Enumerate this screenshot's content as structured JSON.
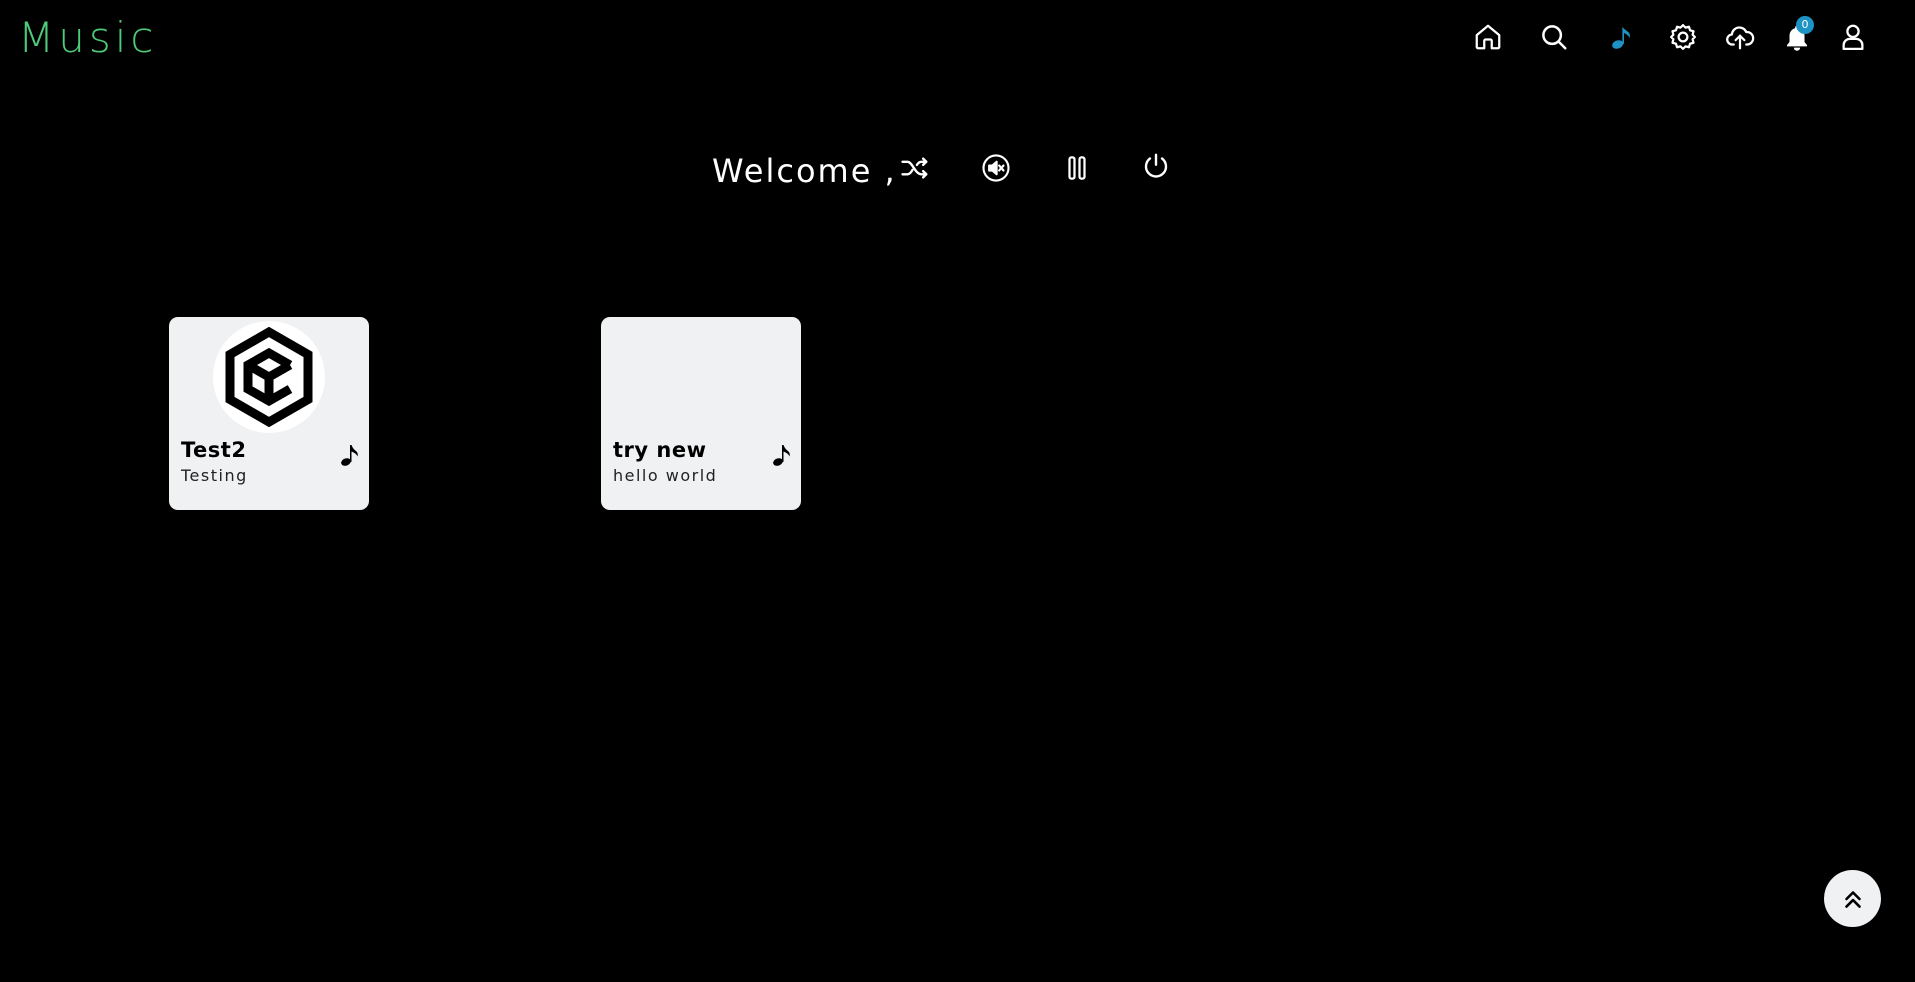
{
  "app": {
    "title": "Music",
    "brand_color": "#4fc97a"
  },
  "nav": {
    "items": [
      {
        "name": "home",
        "icon": "home-icon"
      },
      {
        "name": "search",
        "icon": "search-icon"
      },
      {
        "name": "music",
        "icon": "music-note-icon",
        "active": true,
        "color": "#1c93c4"
      },
      {
        "name": "settings",
        "icon": "gear-icon"
      },
      {
        "name": "upload",
        "icon": "cloud-upload-icon"
      },
      {
        "name": "notifications",
        "icon": "bell-icon",
        "badge": "0"
      },
      {
        "name": "profile",
        "icon": "user-icon"
      }
    ],
    "notification_count": "0"
  },
  "welcome": {
    "text": "Welcome ,",
    "controls": [
      {
        "name": "shuffle",
        "icon": "shuffle-icon"
      },
      {
        "name": "mute",
        "icon": "mute-icon"
      },
      {
        "name": "pause",
        "icon": "pause-icon"
      },
      {
        "name": "power",
        "icon": "power-icon"
      }
    ]
  },
  "cards": [
    {
      "title": "Test2",
      "subtitle": "Testing",
      "art": "cube-logo-icon",
      "icon": "music-note-icon"
    },
    {
      "title": "try new",
      "subtitle": "hello world",
      "art": "",
      "icon": "music-note-icon"
    }
  ],
  "scroll_top": {
    "icon": "double-chevron-up-icon"
  }
}
